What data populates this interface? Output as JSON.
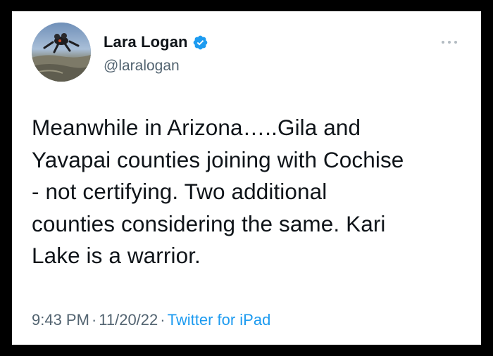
{
  "tweet": {
    "author": {
      "name": "Lara Logan",
      "handle": "@laralogan",
      "verified": true,
      "verified_color": "#1d9bf0"
    },
    "text": "Meanwhile in Arizona…..Gila and\nYavapai counties joining with Cochise\n- not certifying. Two additional\ncounties considering the same. Kari\nLake is a warrior.",
    "time": "9:43 PM",
    "separator": "·",
    "date": "11/20/22",
    "source": "Twitter for iPad"
  },
  "icons": {
    "avatar": "avatar",
    "verified": "verified-badge-icon",
    "more": "more-options-icon"
  },
  "colors": {
    "frame": "#000000",
    "card": "#ffffff",
    "text": "#0f1419",
    "secondary": "#536471",
    "link": "#1d9bf0"
  }
}
